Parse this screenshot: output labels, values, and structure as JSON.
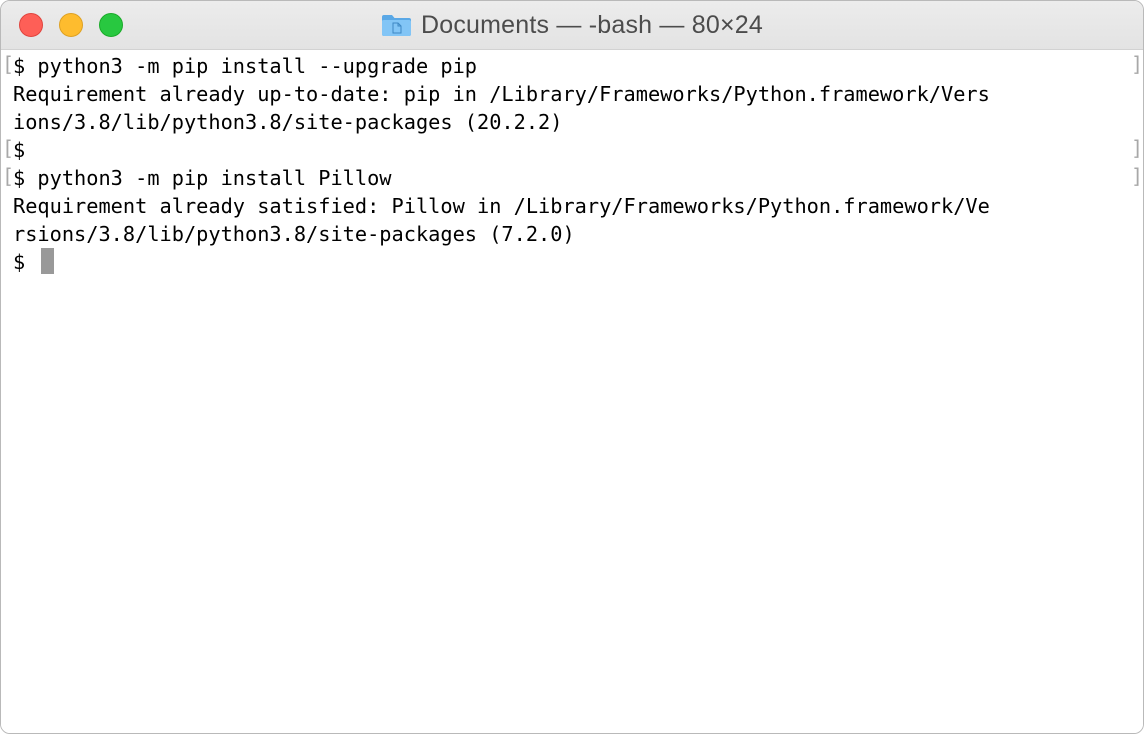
{
  "window": {
    "title": "Documents — -bash — 80×24",
    "title_icon": "folder-icon",
    "traffic_lights": {
      "close_color": "#fe5f57",
      "minimize_color": "#febc2e",
      "zoom_color": "#28c840"
    }
  },
  "terminal": {
    "lines": [
      "$ python3 -m pip install --upgrade pip",
      "Requirement already up-to-date: pip in /Library/Frameworks/Python.framework/Vers",
      "ions/3.8/lib/python3.8/site-packages (20.2.2)",
      "$",
      "$ python3 -m pip install Pillow",
      "Requirement already satisfied: Pillow in /Library/Frameworks/Python.framework/Ve",
      "rsions/3.8/lib/python3.8/site-packages (7.2.0)",
      "$"
    ],
    "mark_open": "[",
    "mark_close": "]"
  }
}
